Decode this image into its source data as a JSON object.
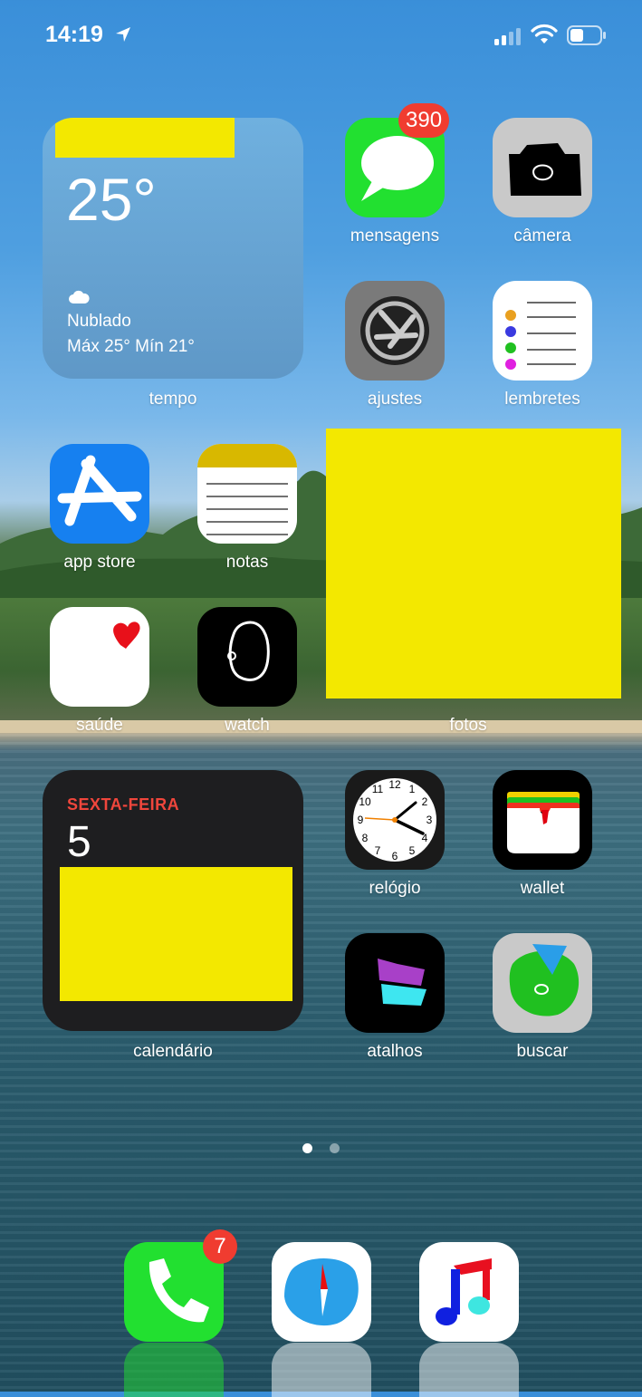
{
  "status_bar": {
    "time": "14:19"
  },
  "widgets": {
    "weather": {
      "temperature": "25°",
      "condition": "Nublado",
      "range": "Máx 25° Mín 21°",
      "label": "tempo"
    },
    "calendar": {
      "weekday": "SEXTA-FEIRA",
      "date": "5",
      "label": "calendário"
    }
  },
  "apps": {
    "mensagens": {
      "label": "mensagens",
      "badge": "390"
    },
    "camera": {
      "label": "câmera"
    },
    "ajustes": {
      "label": "ajustes"
    },
    "lembretes": {
      "label": "lembretes"
    },
    "app_store": {
      "label": "app store"
    },
    "notas": {
      "label": "notas"
    },
    "saude": {
      "label": "saúde"
    },
    "watch": {
      "label": "watch"
    },
    "fotos": {
      "label": "fotos"
    },
    "relogio": {
      "label": "relógio"
    },
    "wallet": {
      "label": "wallet"
    },
    "atalhos": {
      "label": "atalhos"
    },
    "buscar": {
      "label": "buscar"
    }
  },
  "dock": {
    "phone_badge": "7"
  },
  "page_indicator": {
    "pages": 2,
    "current": 1
  },
  "colors": {
    "badge": "#f03c30",
    "redaction": "#f3e800",
    "messages_green": "#22e030"
  }
}
